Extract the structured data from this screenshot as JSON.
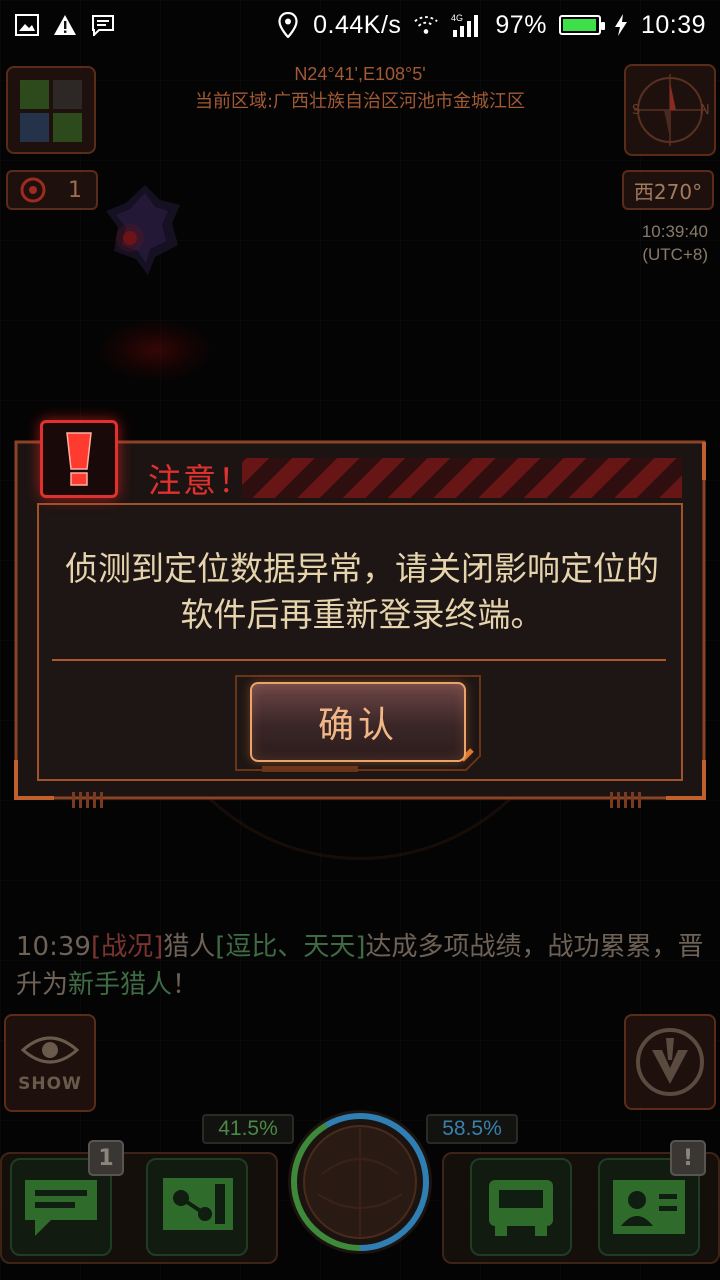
{
  "status_bar": {
    "network_speed": "0.44K/s",
    "network_type": "4G",
    "battery_percent": "97%",
    "battery_level": 0.97,
    "time": "10:39",
    "icons": [
      "image-icon",
      "warning-icon",
      "message-icon",
      "location-pin-icon",
      "wifi-icon",
      "signal-icon",
      "battery-icon",
      "charging-icon"
    ]
  },
  "hud": {
    "coordinates": "N24°41',E108°5'",
    "current_region": "当前区域:广西壮族自治区河池市金城江区",
    "kill_count": "1",
    "heading": "西270°",
    "clock_time": "10:39:40",
    "clock_tz": "(UTC+8)"
  },
  "feed": {
    "time": "10:39",
    "tag": "[战况]",
    "text1": "猎人",
    "names": "[逗比、天天]",
    "text2": "达成多项战绩，战功累累，晋升为",
    "rank": "新手猎人",
    "end": "！"
  },
  "controls": {
    "show_label": "SHOW",
    "left_percent": "41.5%",
    "right_percent": "58.5%",
    "left_level": 0.415,
    "right_level": 0.585,
    "messages_badge": "1",
    "profile_badge": "!"
  },
  "dialog": {
    "title": "注意！",
    "message_line1": "侦测到定位数据异常，请关闭影响定位的",
    "message_line2": "软件后再重新登录终端。",
    "confirm_label": "确认"
  },
  "colors": {
    "accent_orange": "#e06a2c",
    "alert_red": "#e0312e",
    "message_text": "#e6d4ad",
    "button_text": "#f2b787",
    "friendly_green": "#3f6b44",
    "team_blue": "#3a80a8"
  }
}
